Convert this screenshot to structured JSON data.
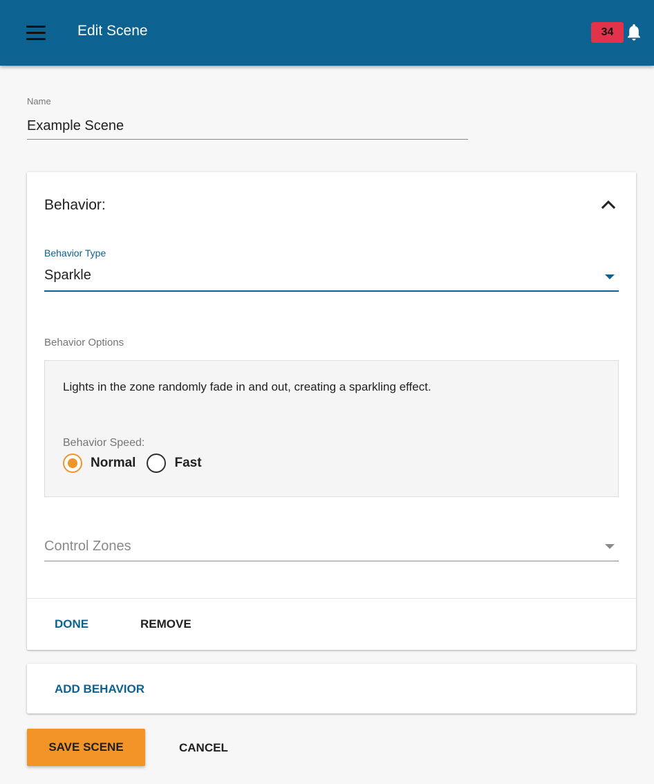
{
  "app_bar": {
    "title": "Edit Scene",
    "notification_count": "34",
    "background_color": "#0c6290",
    "badge_color": "#e2334b",
    "menu_icon": "hamburger-menu-icon",
    "bell_icon": "bell-icon"
  },
  "name_field": {
    "label": "Name",
    "value": "Example Scene"
  },
  "behavior_card": {
    "header": "Behavior:",
    "collapse_icon": "chevron-up-icon",
    "behavior_type": {
      "label": "Behavior Type",
      "selected": "Sparkle"
    },
    "options_label": "Behavior Options",
    "options": {
      "description": "Lights in the zone randomly fade in and out, creating a sparkling effect.",
      "speed_label": "Behavior Speed:",
      "speeds": [
        {
          "label": "Normal",
          "checked": true
        },
        {
          "label": "Fast",
          "checked": false
        }
      ]
    },
    "control_zones": {
      "placeholder": "Control Zones"
    },
    "actions": {
      "done": "DONE",
      "remove": "REMOVE"
    }
  },
  "add_behavior": {
    "label": "ADD BEHAVIOR"
  },
  "footer": {
    "save": "SAVE SCENE",
    "cancel": "CANCEL",
    "save_color": "#f29427"
  }
}
